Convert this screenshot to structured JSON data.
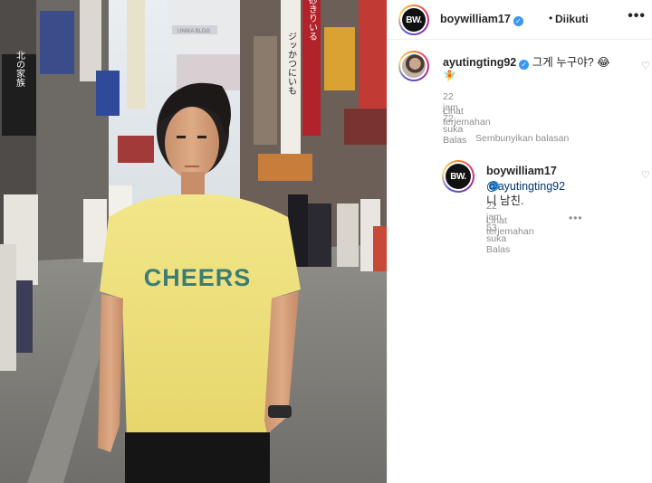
{
  "post": {
    "author": "boywilliam17",
    "avatar_text": "BW.",
    "follow_status": "Diikuti",
    "separator": "•",
    "more_icon": "more-horizontal-icon",
    "photo": {
      "shirt_text": "CHEERS",
      "sign_left": "北の家族",
      "sign_banner": "UNIKA BLDG",
      "sign_vertical_1": "ジッかつにいも",
      "sign_vertical_2": "砂きりいる"
    }
  },
  "comments": [
    {
      "username": "ayutingting92",
      "text": "그게 누구야? 😂",
      "emoji_line": "🧚",
      "time": "22 jam",
      "likes": "72 suka",
      "reply": "Balas",
      "translate": "Lihat terjemahan"
    }
  ],
  "replies_toggle": "Sembunyikan balasan",
  "replies": [
    {
      "username": "boywilliam17",
      "avatar_text": "BW.",
      "mention": "@ayutingting92",
      "text": " 니 남친.",
      "time": "22 jam",
      "likes": "53 suka",
      "reply": "Balas",
      "more": "•••",
      "translate": "Lihat terjemahan"
    }
  ],
  "colors": {
    "verified": "#3897f0",
    "muted": "#8e8e8e",
    "mention": "#00376b",
    "shirt": "#efe27a",
    "shirt_text": "#3c7d73"
  }
}
